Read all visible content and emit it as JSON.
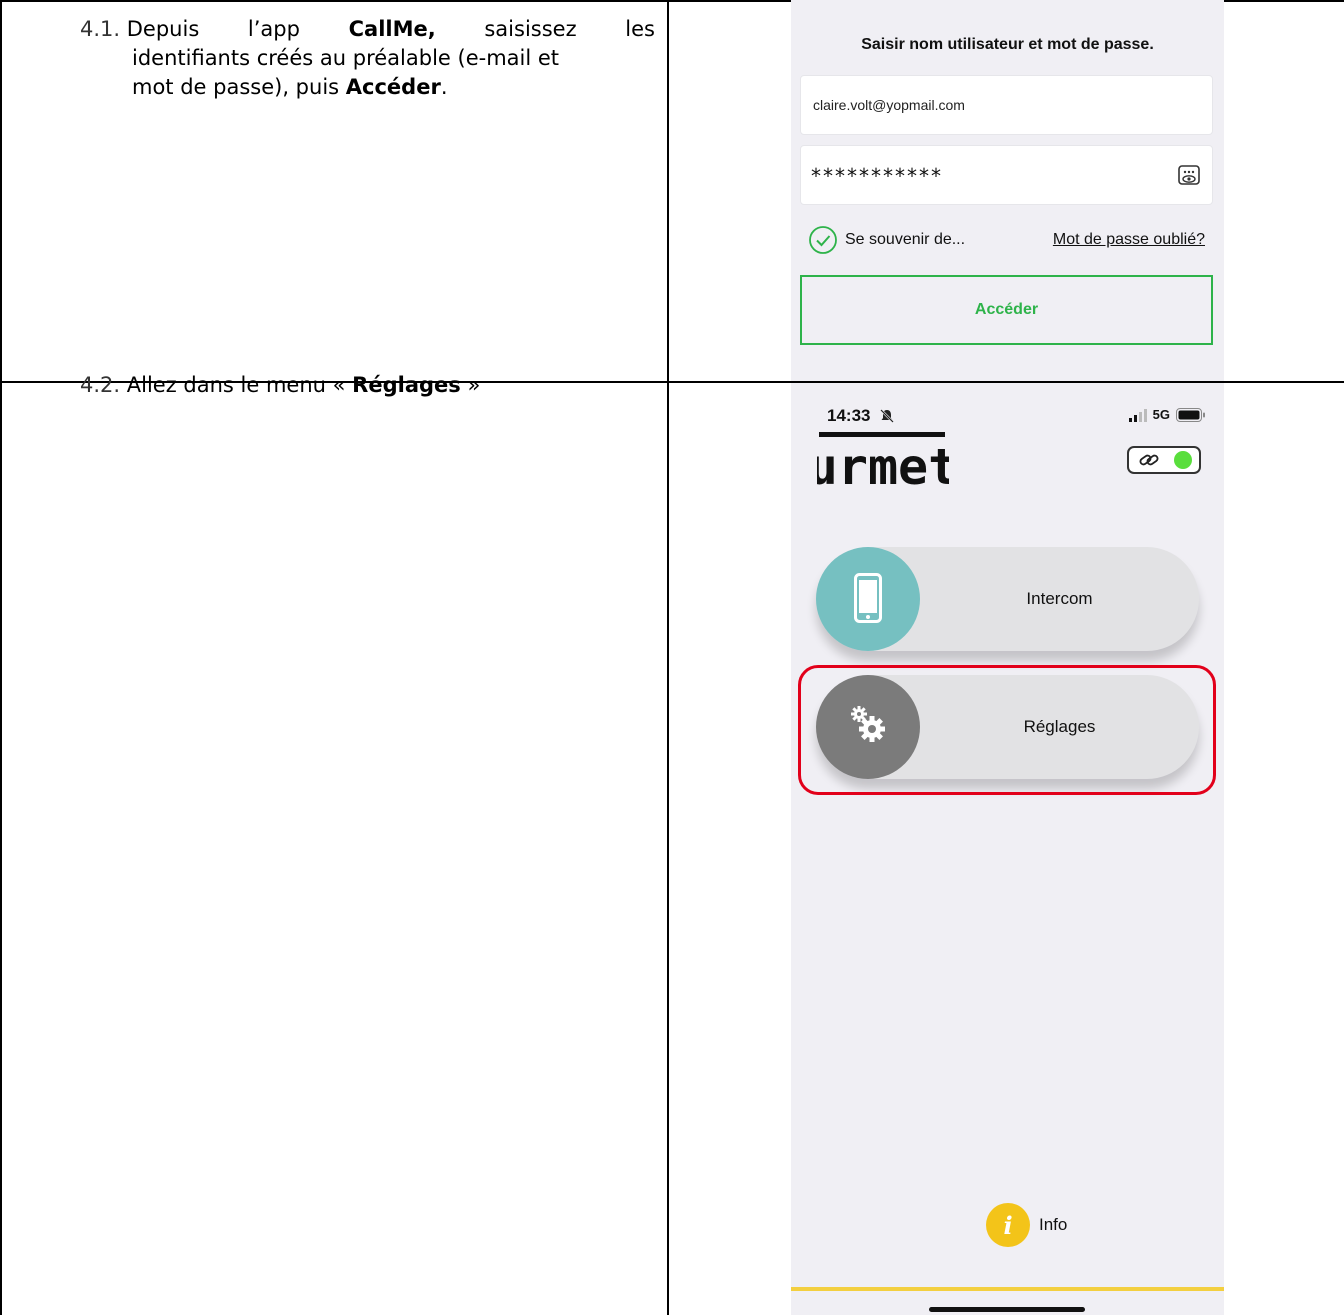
{
  "steps": [
    {
      "number": "4.1.",
      "line1": {
        "w1": "Depuis",
        "w2": "l’app",
        "w3": "CallMe,",
        "w4": "saisissez",
        "w5": "les"
      },
      "line2": "identifiants créés au préalable (e-mail et",
      "line3_a": "mot de passe), puis ",
      "line3_bold": "Accéder",
      "line3_end": "."
    },
    {
      "number": "4.2.",
      "text_before": "Allez dans le menu « ",
      "bold": "Réglages",
      "text_after": " »"
    }
  ],
  "login_screen": {
    "title": "Saisir nom utilisateur et mot de passe.",
    "email_value": "claire.volt@yopmail.com",
    "password_value": "***********",
    "remember_label": "Se souvenir de...",
    "forgot_label": "Mot de passe oublié?",
    "access_label": "Accéder",
    "accent_color": "#2eb34a"
  },
  "home_screen": {
    "status_time": "14:33",
    "network": "5G",
    "brand": "urmet",
    "menu": [
      {
        "label": "Intercom",
        "icon": "smartphone-icon",
        "color": "#76c0c1"
      },
      {
        "label": "Réglages",
        "icon": "gears-icon",
        "color": "#7b7b7b",
        "highlighted": true
      }
    ],
    "info_label": "Info",
    "highlight_color": "#e2001a"
  }
}
